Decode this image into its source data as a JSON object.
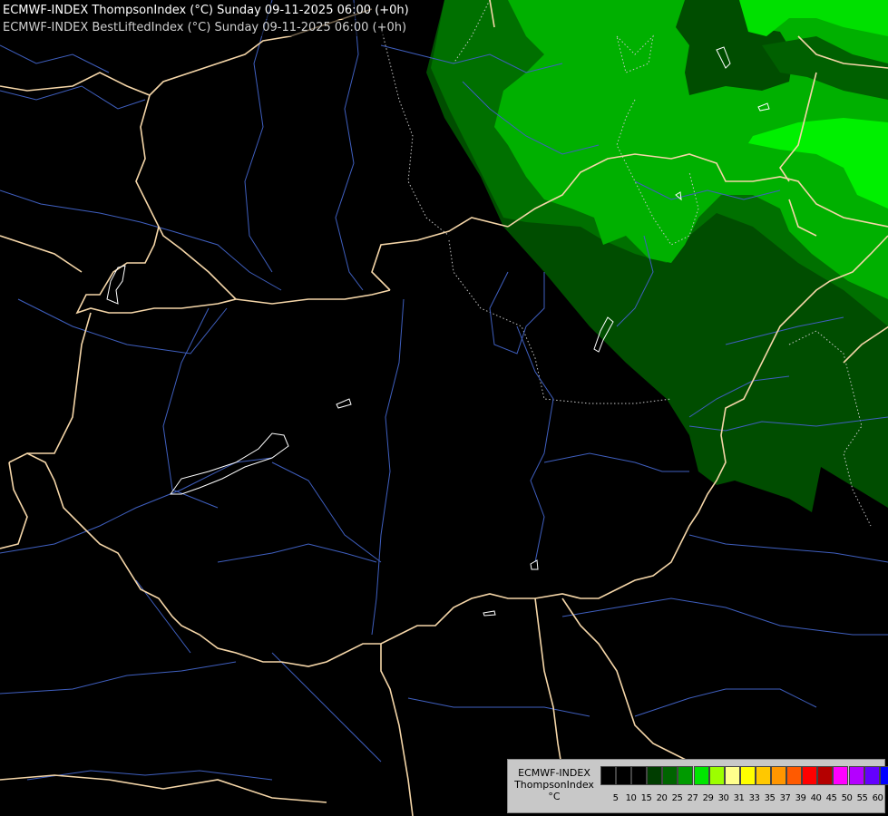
{
  "header": {
    "line1": "ECMWF-INDEX ThompsonIndex (°C) Sunday 09-11-2025 06:00 (+0h)",
    "line2": "ECMWF-INDEX BestLiftedIndex (°C) Sunday 09-11-2025 06:00 (+0h)"
  },
  "legend": {
    "model": "ECMWF-INDEX",
    "parameter": "ThompsonIndex",
    "unit": "°C",
    "levels": [
      "5",
      "10",
      "15",
      "20",
      "25",
      "27",
      "29",
      "30",
      "31",
      "33",
      "35",
      "37",
      "39",
      "40",
      "45",
      "50",
      "55",
      "60"
    ],
    "colors": [
      "#000000",
      "#000000",
      "#000000",
      "#003d00",
      "#006400",
      "#009a00",
      "#00e600",
      "#9cff00",
      "#ffff8c",
      "#ffff00",
      "#ffc800",
      "#ff9600",
      "#ff5a00",
      "#ff0000",
      "#b40000",
      "#ff00ff",
      "#b400ff",
      "#6400ff",
      "#0000ff"
    ]
  },
  "map": {
    "colors": {
      "background": "#000000",
      "border": "#f5d6a8",
      "river": "#3f5fbf",
      "lake": "#ffffff",
      "dotted": "#c8c8c8",
      "green_dark": "#004d00",
      "green_mid": "#006f00",
      "green_bright": "#00b400",
      "green_brightest": "#00ff00"
    }
  }
}
